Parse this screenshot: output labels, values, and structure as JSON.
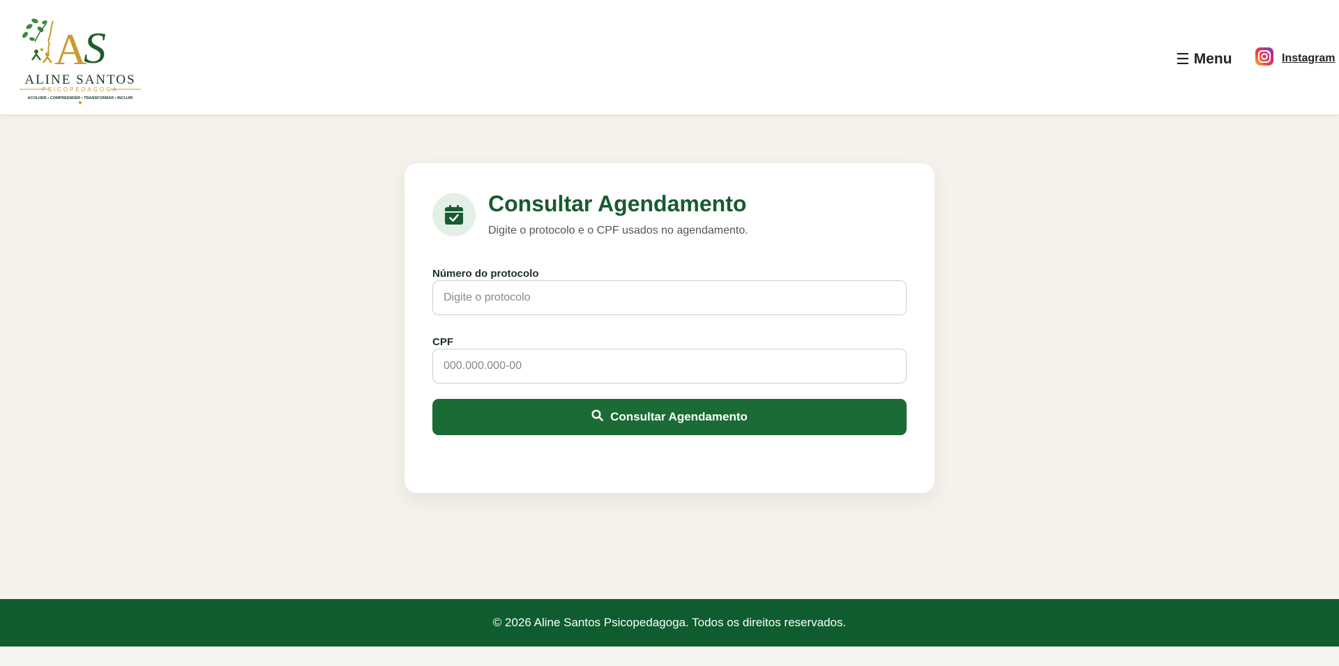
{
  "header": {
    "logo": {
      "brand_name": "ALINE SANTOS",
      "brand_tagline": "PSICOPEDAGOGA",
      "brand_motto": "ACOLHER • COMPREENDER • TRANSFORMAR • INCLUIR",
      "monogram": "AS"
    },
    "menu_label": "Menu",
    "instagram_label": "Instagram"
  },
  "card": {
    "icon": "calendar-check-icon",
    "title": "Consultar Agendamento",
    "subtitle": "Digite o protocolo e o CPF usados no agendamento.",
    "protocol": {
      "label": "Número do protocolo",
      "placeholder": "Digite o protocolo",
      "value": ""
    },
    "cpf": {
      "label": "CPF",
      "placeholder": "000.000.000-00",
      "value": ""
    },
    "submit_label": "Consultar Agendamento",
    "submit_icon": "search-icon"
  },
  "footer": {
    "text": "© 2026 Aline Santos Psicopedagoga. Todos os direitos reservados."
  },
  "colors": {
    "brand_green": "#1a6b36",
    "title_green": "#195a31",
    "footer_green": "#0f5c2e",
    "page_background": "#f5f2eb",
    "icon_circle": "#e4efe5",
    "gold": "#c99a2e"
  }
}
